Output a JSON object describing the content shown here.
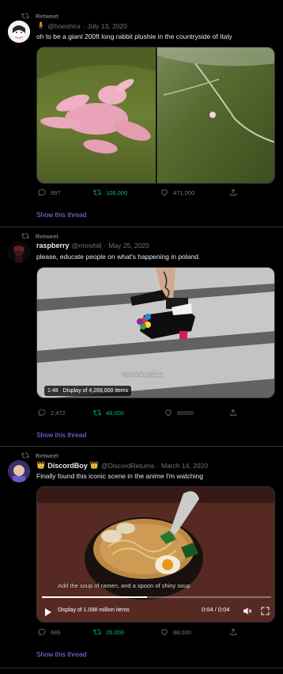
{
  "tweets": [
    {
      "retweet_label": "Retweet",
      "handle": "@hoeshira",
      "separator": "·",
      "date": "July 13, 2020",
      "text": "oh to be a giant 200ft long rabbit plushie in the countryside of Italy",
      "replies": "997",
      "retweets": "106,000",
      "likes": "471,000",
      "thread_link": "Show this thread"
    },
    {
      "retweet_label": "Retweet",
      "name": "raspberry",
      "handle": "@rmnvhill",
      "separator": "·",
      "date": "May 25, 2020",
      "text": "please, educate people on what's happening in poland.",
      "video_duration": "1:48",
      "video_views": "Display of 4,269,000 items",
      "caption": "Fuck Andrzej Duda",
      "replies": "2,472",
      "retweets": "48,000",
      "likes": "60000",
      "thread_link": "Show this thread"
    },
    {
      "retweet_label": "Retweet",
      "name": "DiscordBoy",
      "handle": "@DiscordReturns",
      "separator": "·",
      "date": "March 14, 2020",
      "text": "Finally found this iconic scene in the anime I'm watching",
      "video_views": "Display of 1.098 million items",
      "video_time": "0:04 / 0:04",
      "subtitle": "Add the soup of ramen, and a spoon of shiny soup",
      "replies": "686",
      "retweets": "26,000",
      "likes": "88,000",
      "thread_link": "Show this thread"
    }
  ],
  "colors": {
    "background": "#000000",
    "text": "#e7e9ea",
    "muted": "#71767b",
    "retweet_green": "#00ba7c",
    "link": "#8b7cf7"
  }
}
